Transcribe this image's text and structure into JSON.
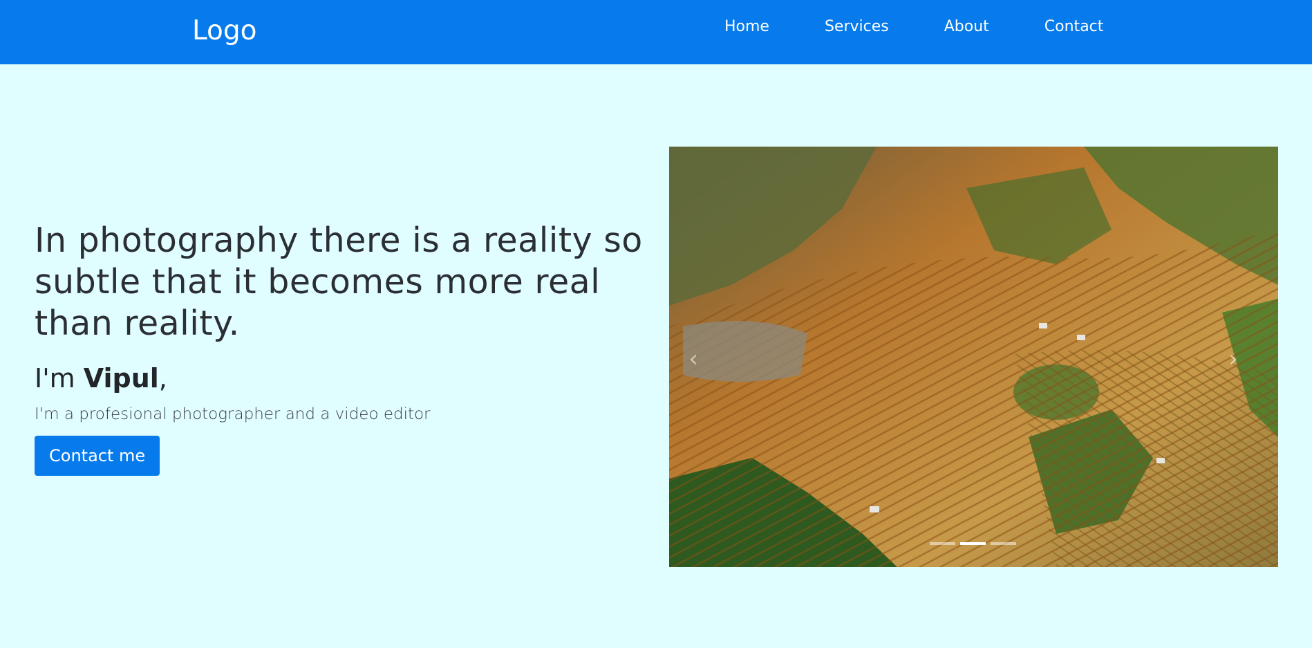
{
  "navbar": {
    "logo": "Logo",
    "links": [
      {
        "label": "Home"
      },
      {
        "label": "Services"
      },
      {
        "label": "About"
      },
      {
        "label": "Contact"
      }
    ]
  },
  "hero": {
    "quote": "In photography there is a reality so subtle that it becomes more real than reality.",
    "intro_prefix": "I'm ",
    "intro_name": "Vipul",
    "intro_suffix": ",",
    "subtitle": "I'm a profesional photographer and a video editor",
    "button_label": "Contact me"
  },
  "carousel": {
    "image_subject": "aerial view of rice terraces",
    "prev_icon": "chevron-left-icon",
    "next_icon": "chevron-right-icon",
    "slide_count": 3,
    "active_slide": 2
  },
  "colors": {
    "navbar_bg": "#077bec",
    "page_bg": "#e0fdff",
    "button_bg": "#077bec",
    "text": "#2b2f33"
  }
}
